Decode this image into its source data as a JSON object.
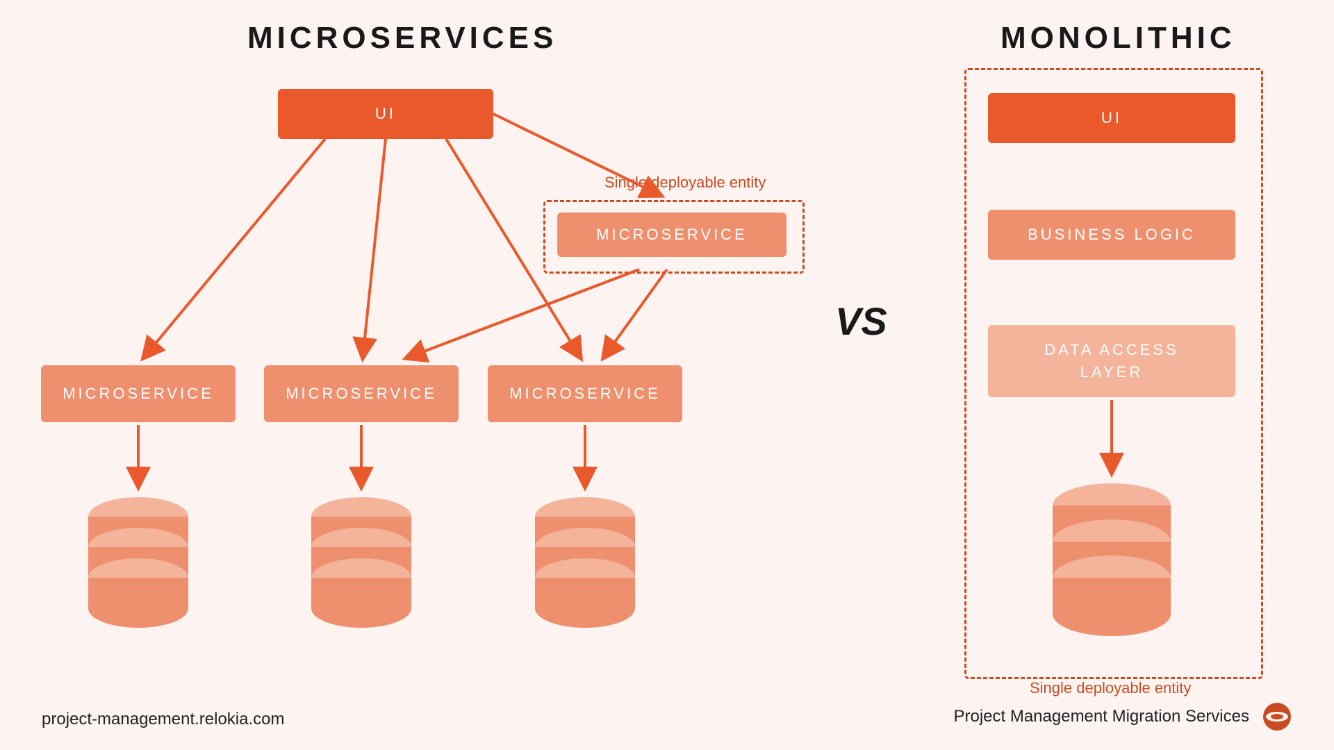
{
  "titles": {
    "left": "MICROSERVICES",
    "right": "MONOLITHIC"
  },
  "vs": "VS",
  "left": {
    "ui": "UI",
    "ms1": "MICROSERVICE",
    "ms2": "MICROSERVICE",
    "ms3": "MICROSERVICE",
    "ms4": "MICROSERVICE",
    "annotation": "Single deployable entity"
  },
  "right": {
    "ui": "UI",
    "bl": "BUSINESS LOGIC",
    "dal": "DATA ACCESS\nLAYER",
    "annotation": "Single deployable entity"
  },
  "footer": {
    "left": "project-management.relokia.com",
    "right": "Project Management Migration Services"
  },
  "colors": {
    "accent": "#E9592B",
    "mid": "#EE8F6E",
    "light": "#F4B39B",
    "dash": "#C84B22",
    "bg": "#FDF4F2"
  }
}
